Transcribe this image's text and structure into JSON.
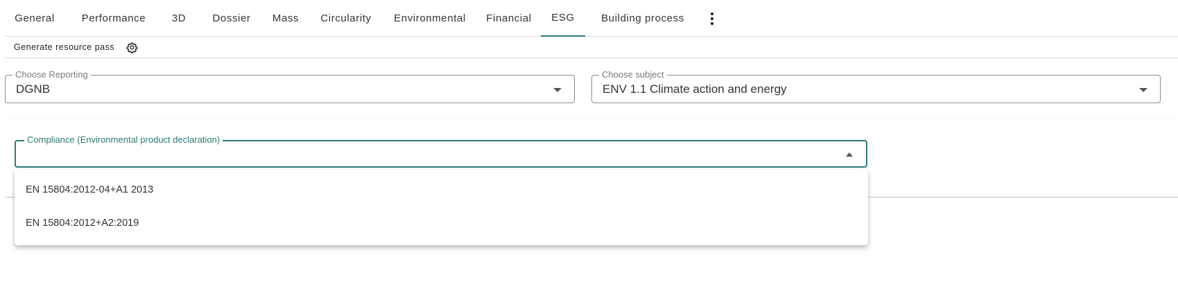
{
  "tabs": [
    {
      "label": "General"
    },
    {
      "label": "Performance"
    },
    {
      "label": "3D"
    },
    {
      "label": "Dossier"
    },
    {
      "label": "Mass"
    },
    {
      "label": "Circularity"
    },
    {
      "label": "Environmental"
    },
    {
      "label": "Financial"
    },
    {
      "label": "ESG",
      "active": true
    },
    {
      "label": "Building process"
    }
  ],
  "toolbar": {
    "generate_label": "Generate resource pass"
  },
  "reporting": {
    "label": "Choose Reporting",
    "value": "DGNB"
  },
  "subject": {
    "label": "Choose subject",
    "value": "ENV 1.1 Climate action and energy"
  },
  "compliance": {
    "label": "Compliance (Environmental product declaration)",
    "value": "",
    "options": [
      {
        "label": "EN 15804:2012-04+A1 2013"
      },
      {
        "label": "EN 15804:2012+A2:2019"
      }
    ]
  },
  "colors": {
    "accent": "#2b7a78"
  }
}
